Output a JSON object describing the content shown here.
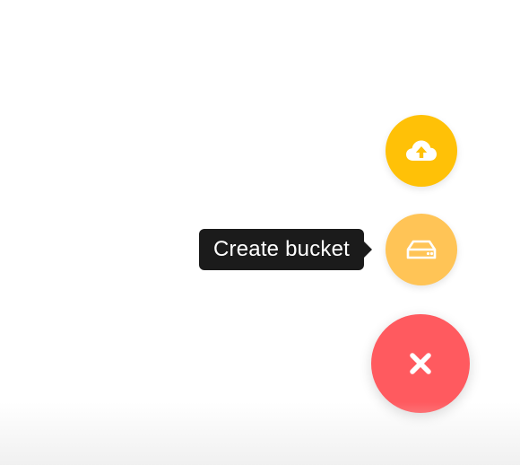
{
  "colors": {
    "upload_fab": "#FFC107",
    "bucket_fab": "#FFC456",
    "close_fab": "#FF5A5F",
    "tooltip_bg": "#1B1B1B",
    "icon": "#FFFFFF"
  },
  "actions": {
    "upload": {
      "icon": "cloud-upload-icon"
    },
    "bucket": {
      "icon": "drive-icon",
      "tooltip": "Create bucket"
    },
    "close": {
      "icon": "close-icon"
    }
  }
}
